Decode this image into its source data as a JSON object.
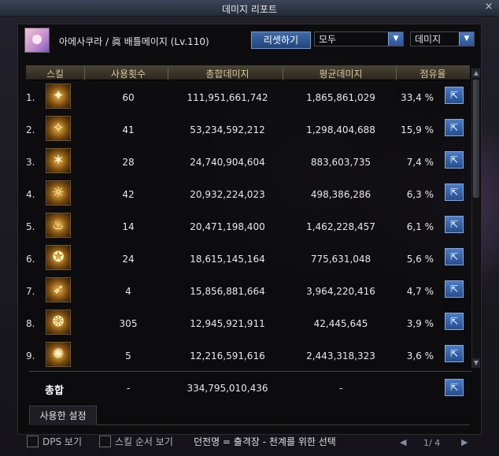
{
  "window": {
    "title": "데미지 리포트",
    "close": "×"
  },
  "header": {
    "character": "아에사쿠라 / 眞 배틀메이지 (Lv.110)",
    "reset_label": "리셋하기",
    "filter_select": "모두",
    "mode_select": "데미지"
  },
  "table": {
    "columns": [
      "스킬",
      "사용횟수",
      "총합데미지",
      "평균데미지",
      "점유율"
    ],
    "rows": [
      {
        "rank": "1.",
        "uses": "60",
        "total": "111,951,661,742",
        "avg": "1,865,861,029",
        "share": "33,4 %"
      },
      {
        "rank": "2.",
        "uses": "41",
        "total": "53,234,592,212",
        "avg": "1,298,404,688",
        "share": "15,9 %"
      },
      {
        "rank": "3.",
        "uses": "28",
        "total": "24,740,904,604",
        "avg": "883,603,735",
        "share": "7,4 %"
      },
      {
        "rank": "4.",
        "uses": "42",
        "total": "20,932,224,023",
        "avg": "498,386,286",
        "share": "6,3 %"
      },
      {
        "rank": "5.",
        "uses": "14",
        "total": "20,471,198,400",
        "avg": "1,462,228,457",
        "share": "6,1 %"
      },
      {
        "rank": "6.",
        "uses": "24",
        "total": "18,615,145,164",
        "avg": "775,631,048",
        "share": "5,6 %"
      },
      {
        "rank": "7.",
        "uses": "4",
        "total": "15,856,881,664",
        "avg": "3,964,220,416",
        "share": "4,7 %"
      },
      {
        "rank": "8.",
        "uses": "305",
        "total": "12,945,921,911",
        "avg": "42,445,645",
        "share": "3,9 %"
      },
      {
        "rank": "9.",
        "uses": "5",
        "total": "12,216,591,616",
        "avg": "2,443,318,323",
        "share": "3,6 %"
      }
    ]
  },
  "total": {
    "label": "총합",
    "uses": "-",
    "total": "334,795,010,436",
    "avg": "-"
  },
  "tab": {
    "label": "사용한 설정"
  },
  "footer": {
    "dps_label": "DPS 보기",
    "skill_order_label": "스킬 순서 보기",
    "dungeon": "던전명 = 출격장 - 천계를 위한 선택",
    "page": "1/ 4"
  },
  "icons": {
    "detail": "share-icon",
    "close": "close-icon"
  }
}
